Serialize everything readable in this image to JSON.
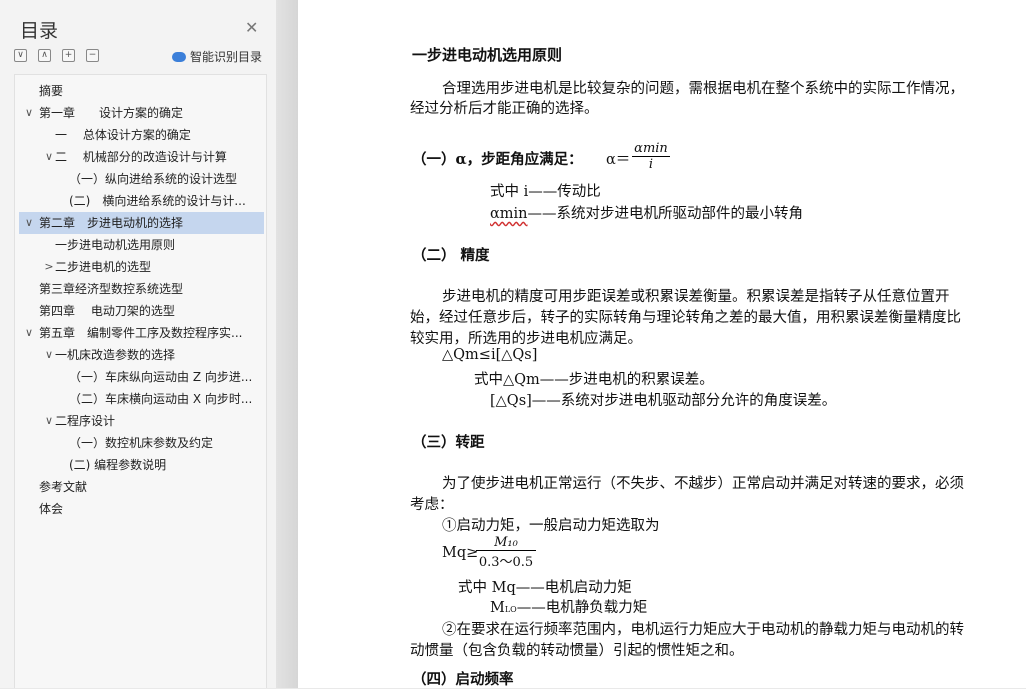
{
  "sidebar": {
    "title": "目录",
    "smart_label": "智能识别目录",
    "toolbar": [
      "∨",
      "∧",
      "+",
      "−"
    ],
    "items": [
      {
        "label": "摘要",
        "arrow": "",
        "indent": 0
      },
      {
        "label": "第一章　　设计方案的确定",
        "arrow": "∨",
        "indent": 0
      },
      {
        "label": "一　 总体设计方案的确定",
        "arrow": "",
        "indent": 1
      },
      {
        "label": "二　 机械部分的改造设计与计算",
        "arrow": "∨",
        "indent": 1
      },
      {
        "label": "（一）纵向进给系统的设计选型",
        "arrow": "",
        "indent": 2
      },
      {
        "label": "(二)　横向进给系统的设计与计...",
        "arrow": "",
        "indent": 2
      },
      {
        "label": "第二章　步进电动机的选择",
        "arrow": "∨",
        "indent": 0,
        "selected": true
      },
      {
        "label": "一步进电动机选用原则",
        "arrow": "",
        "indent": 1
      },
      {
        "label": "二步进电机的选型",
        "arrow": ">",
        "indent": 1
      },
      {
        "label": "第三章经济型数控系统选型",
        "arrow": "",
        "indent": 0
      },
      {
        "label": "第四章　 电动刀架的选型",
        "arrow": "",
        "indent": 0
      },
      {
        "label": "第五章　编制零件工序及数控程序实...",
        "arrow": "∨",
        "indent": 0
      },
      {
        "label": "一机床改造参数的选择",
        "arrow": "∨",
        "indent": 1
      },
      {
        "label": "（一）车床纵向运动由 Z 向步进...",
        "arrow": "",
        "indent": 2
      },
      {
        "label": "（二）车床横向运动由 X 向步时...",
        "arrow": "",
        "indent": 2
      },
      {
        "label": "二程序设计",
        "arrow": "∨",
        "indent": 1
      },
      {
        "label": "（一）数控机床参数及约定",
        "arrow": "",
        "indent": 2
      },
      {
        "label": "(二) 编程参数说明",
        "arrow": "",
        "indent": 2
      },
      {
        "label": "参考文献",
        "arrow": "",
        "indent": 0
      },
      {
        "label": "体会",
        "arrow": "",
        "indent": 0
      }
    ]
  },
  "doc": {
    "heading": "一步进电动机选用原则",
    "intro1": "合理选用步进电机是比较复杂的问题，需根据电机在整个系统中的实际工作情况，",
    "intro2": "经过分析后才能正确的选择。",
    "s1_head": "（一）α，步距角应满足：",
    "s1_formula_lhs": "α＝",
    "s1_formula_num": "αmin",
    "s1_formula_den": "i",
    "s1_where1": "式中 i——传动比",
    "s1_where2_a": "αmin",
    "s1_where2_b": "——系统对步进电机所驱动部件的最小转角",
    "s2_head": "（二） 精度",
    "s2_p1": "步进电机的精度可用步距误差或积累误差衡量。积累误差是指转子从任意位置开",
    "s2_p2": "始，经过任意步后，转子的实际转角与理论转角之差的最大值，用积累误差衡量精度比",
    "s2_p3": "较实用，所选用的步进电机应满足。",
    "s2_f1": "△Qm≤i[△Qs]",
    "s2_f2": "式中△Qm——步进电机的积累误差。",
    "s2_f3": "[△Qs]——系统对步进电机驱动部分允许的角度误差。",
    "s3_head": "（三）转距",
    "s3_p1": "为了使步进电机正常运行（不失步、不越步）正常启动并满足对转速的要求，必须",
    "s3_p2": "考虑：",
    "s3_c1": "①启动力矩，一般启动力矩选取为",
    "s3_f_lhs": "Mq≥",
    "s3_f_num": "M₁₀",
    "s3_f_den": "0.3～0.5",
    "s3_w1": "式中 Mq——电机启动力矩",
    "s3_w2_a": "M",
    "s3_w2_sub": "LO",
    "s3_w2_b": "——电机静负载力矩",
    "s3_c2_1": "②在要求在运行频率范围内，电机运行力矩应大于电动机的静载力矩与电动机的转",
    "s3_c2_2": "动惯量（包含负载的转动惯量）引起的惯性矩之和。",
    "s4_head": "（四）启动频率"
  }
}
